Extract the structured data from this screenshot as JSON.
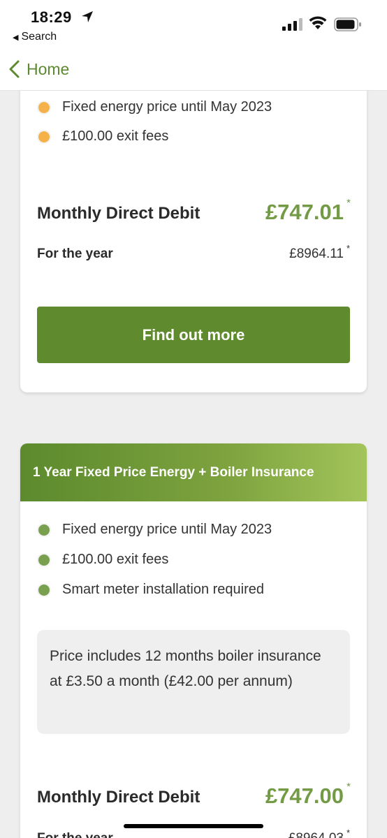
{
  "status_bar": {
    "time": "18:29",
    "back_label": "Search"
  },
  "nav": {
    "back_label": "Home"
  },
  "card1": {
    "features": [
      {
        "label": "Fixed energy price until May 2023",
        "dot_color": "#f6b24a"
      },
      {
        "label": "£100.00 exit fees",
        "dot_color": "#f6b24a"
      }
    ],
    "monthly_label": "Monthly Direct Debit",
    "monthly_price": "£747.01",
    "monthly_asterisk": "*",
    "year_label": "For the year",
    "year_price": "£8964.11",
    "year_asterisk": "*",
    "cta_label": "Find out more"
  },
  "card2": {
    "title": "1 Year Fixed Price Energy + Boiler Insurance",
    "features": [
      {
        "label": "Fixed energy price until May 2023",
        "dot_color": "#78a04f"
      },
      {
        "label": "£100.00 exit fees",
        "dot_color": "#78a04f"
      },
      {
        "label": "Smart meter installation required",
        "dot_color": "#78a04f"
      }
    ],
    "info_text": "Price includes 12 months boiler insurance at £3.50 a month (£42.00 per annum)",
    "monthly_label": "Monthly Direct Debit",
    "monthly_price": "£747.00",
    "monthly_asterisk": "*",
    "year_label": "For the year",
    "year_price": "£8964.03",
    "year_asterisk": "*"
  },
  "colors": {
    "accent": "#5f8a2d",
    "price": "#739a45",
    "orange_dot": "#f6b24a",
    "green_dot": "#78a04f"
  }
}
